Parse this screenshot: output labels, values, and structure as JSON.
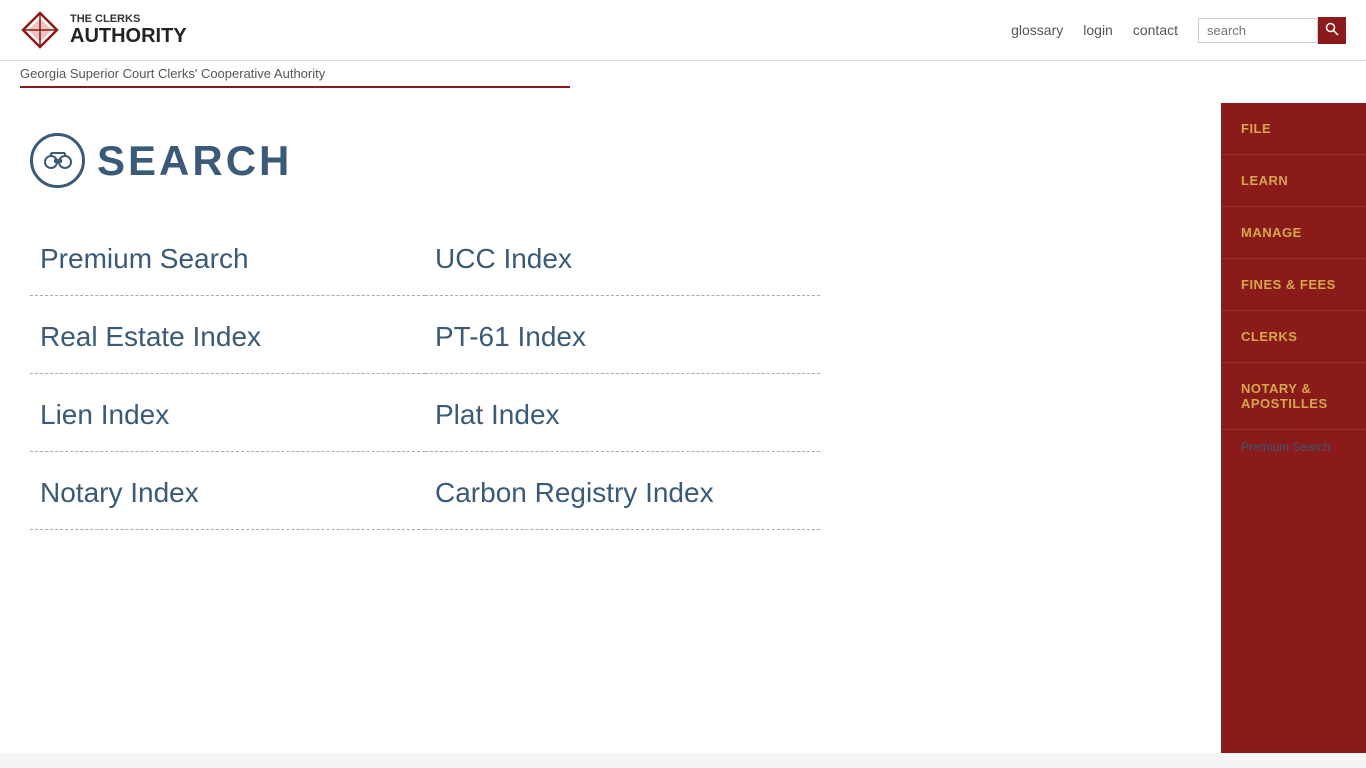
{
  "header": {
    "logo_line1": "THE CLERKS",
    "logo_line2": "AUTHORITY",
    "tagline": "Georgia Superior Court Clerks' Cooperative Authority",
    "nav": {
      "glossary": "glossary",
      "login": "login",
      "contact": "contact"
    },
    "search_placeholder": "search"
  },
  "page": {
    "title": "SEARCH"
  },
  "sidebar": {
    "items": [
      {
        "id": "file",
        "label": "FILE"
      },
      {
        "id": "learn",
        "label": "LEARN"
      },
      {
        "id": "manage",
        "label": "MANAGE"
      },
      {
        "id": "fines-fees",
        "label": "FINES & FEES"
      },
      {
        "id": "clerks",
        "label": "CLERKS"
      },
      {
        "id": "notary",
        "label": "NOTARY & APOSTILLES"
      }
    ]
  },
  "search_items": [
    {
      "id": "premium-search",
      "label": "Premium Search"
    },
    {
      "id": "ucc-index",
      "label": "UCC Index"
    },
    {
      "id": "real-estate-index",
      "label": "Real Estate Index"
    },
    {
      "id": "pt61-index",
      "label": "PT-61 Index"
    },
    {
      "id": "lien-index",
      "label": "Lien Index"
    },
    {
      "id": "plat-index",
      "label": "Plat Index"
    },
    {
      "id": "notary-index",
      "label": "Notary Index"
    },
    {
      "id": "carbon-registry-index",
      "label": "Carbon Registry Index"
    }
  ],
  "premium_search_img_alt": "Premium Search"
}
